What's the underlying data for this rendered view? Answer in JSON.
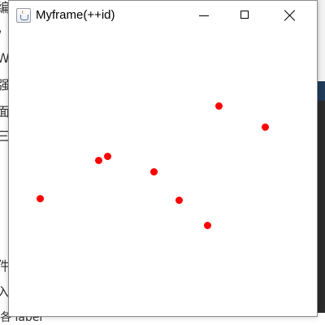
{
  "window": {
    "title": "Myframe(++id)",
    "icon": "java-app-icon",
    "controls": [
      "minimize-icon",
      "maximize-icon",
      "close-icon"
    ]
  },
  "background_fragments": {
    "left_glyphs": [
      "编",
      "/",
      "W",
      "强",
      "面",
      "三",
      "件",
      "入"
    ],
    "bottom_text": "各 label"
  },
  "canvas": {
    "dot_color": "#ff0000",
    "dot_count": 8
  },
  "colors": {
    "titlebar_bg": "#ffffff",
    "canvas_bg": "#ffffff",
    "editor_dark": "#2b2b2b",
    "editor_accent": "#1f3b5a"
  }
}
